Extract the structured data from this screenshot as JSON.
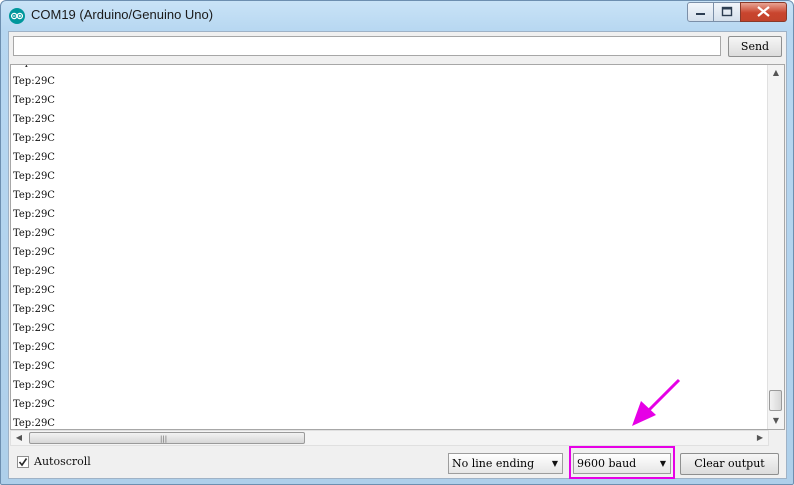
{
  "window": {
    "title": "COM19 (Arduino/Genuino Uno)",
    "icon": "arduino-logo-icon",
    "controls": [
      "minimize-icon",
      "maximize-icon",
      "close-icon"
    ]
  },
  "send_bar": {
    "input_value": "",
    "send_label": "Send"
  },
  "serial_output": {
    "lines": [
      "Tep:29C",
      "Tep:29C",
      "Tep:29C",
      "Tep:29C",
      "Tep:29C",
      "Tep:29C",
      "Tep:29C",
      "Tep:29C",
      "Tep:29C",
      "Tep:29C",
      "Tep:29C",
      "Tep:29C",
      "Tep:29C",
      "Tep:29C",
      "Tep:29C",
      "Tep:29C",
      "Tep:29C",
      "Tep:29C",
      "Tep:29C",
      "Tep:29C",
      "Tep:29C"
    ]
  },
  "footer": {
    "autoscroll_label": "Autoscroll",
    "autoscroll_checked": true,
    "line_ending": "No line ending",
    "baud_rate": "9600 baud",
    "clear_label": "Clear output"
  },
  "annotation": {
    "color": "#e600e6",
    "target": "baud-rate-select"
  }
}
